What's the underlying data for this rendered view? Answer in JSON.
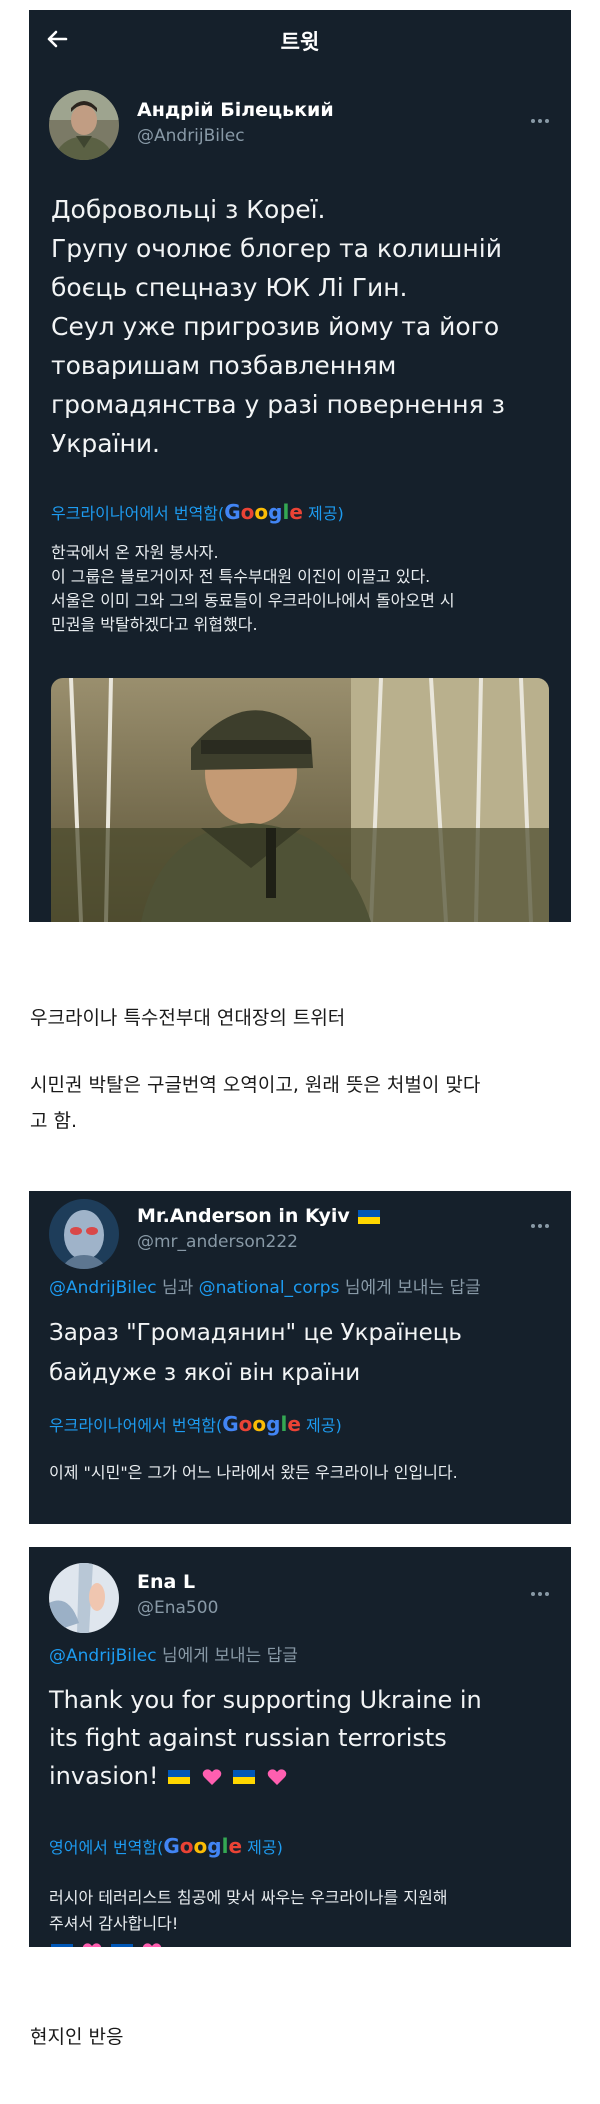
{
  "card1": {
    "header_title": "트윗",
    "author_name": "Андрій Білецький",
    "author_handle": "@AndrijBilec",
    "tweet_lines": [
      "Добровольці з Кореї.",
      "Групу очолює блогер та колишній",
      "боєць спецназу ЮК Лі Гин.",
      "Сеул уже пригрозив йому та його",
      "товаришам позбавленням",
      "громадянства у разі повернення з",
      "України."
    ],
    "translate_prefix": "우크라이나어에서 번역함(",
    "translate_google": "Google",
    "translate_suffix": " 제공)",
    "translated_lines": [
      "한국에서 온 자원 봉사자.",
      " 이 그룹은 블로거이자 전 특수부대원 이진이 이끌고 있다.",
      " 서울은 이미 그와 그의 동료들이 우크라이나에서 돌아오면 시",
      "민권을 박탈하겠다고 위협했다."
    ]
  },
  "caption1": "우크라이나 특수전부대 연대장의 트위터",
  "caption2_lines": [
    "시민권 박탈은 구글번역 오역이고, 원래 뜻은 처벌이 맞다",
    "고 함."
  ],
  "card2": {
    "author_name": "Mr.Anderson in Kyiv",
    "author_handle": "@mr_anderson222",
    "reply_mention1": "@AndrijBilec",
    "reply_mid": " 님과 ",
    "reply_mention2": "@national_corps",
    "reply_tail": " 님에게 보내는 답글",
    "tweet_lines": [
      "Зараз \"Громадянин\" це Українець",
      "байдуже з якої він країни"
    ],
    "translate_prefix": "우크라이나어에서 번역함(",
    "translate_google": "Google",
    "translate_suffix": " 제공)",
    "translated_lines": [
      "이제 \"시민\"은 그가 어느 나라에서 왔든 우크라이나 인입니다."
    ]
  },
  "card3": {
    "author_name": "Ena L",
    "author_handle": "@Ena500",
    "reply_mention1": "@AndrijBilec",
    "reply_tail": " 님에게 보내는 답글",
    "tweet_lines": [
      "Thank you for supporting Ukraine in",
      "its fight against russian terrorists",
      "invasion!"
    ],
    "translate_prefix": "영어에서 번역함(",
    "translate_google": "Google",
    "translate_suffix": " 제공)",
    "translated_lines": [
      "러시아 테러리스트 침공에 맞서 싸우는 우크라이나를 지원해",
      "주셔서 감사합니다!"
    ]
  },
  "caption3": "현지인 반응",
  "colors": {
    "card_bg": "#15202b",
    "link_blue": "#1d9bf0",
    "muted": "#8899a6",
    "ukraine_blue": "#0057b7",
    "ukraine_yellow": "#ffd700",
    "heart_pink": "#ff5fb0"
  }
}
